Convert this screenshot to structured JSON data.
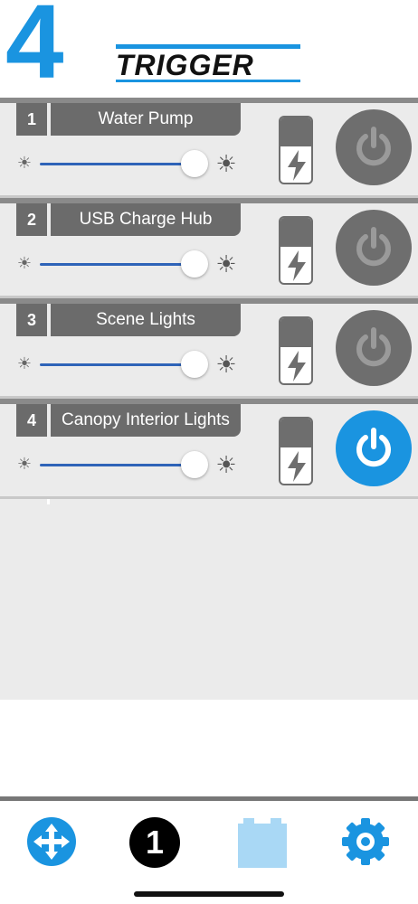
{
  "header": {
    "logo_number": "4",
    "logo_word": "TRIGGER"
  },
  "rows": [
    {
      "number": "1",
      "name": "Water Pump",
      "brightness_percent": 100,
      "power_on": false
    },
    {
      "number": "2",
      "name": "USB Charge Hub",
      "brightness_percent": 100,
      "power_on": false
    },
    {
      "number": "3",
      "name": "Scene Lights",
      "brightness_percent": 100,
      "power_on": false
    },
    {
      "number": "4",
      "name": "Canopy Interior Lights",
      "brightness_percent": 100,
      "power_on": true
    }
  ],
  "tabbar": {
    "group_number": "1",
    "icons": [
      "move-icon",
      "group-number-badge",
      "battery-icon",
      "settings-gear-icon"
    ]
  },
  "colors": {
    "accent": "#1a94e0",
    "off_gray": "#6e6e6e",
    "slider": "#2e63b8",
    "panel_bg": "#ebebeb"
  }
}
